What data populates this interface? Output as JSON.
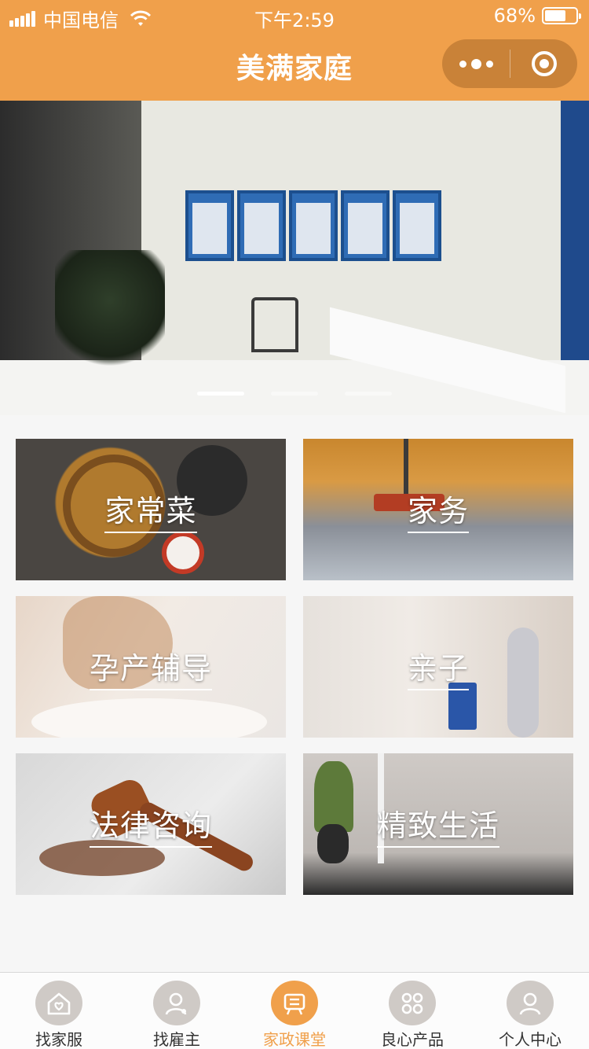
{
  "status_bar": {
    "carrier": "中国电信",
    "time": "下午2:59",
    "battery": "68%",
    "battery_level": 0.68
  },
  "nav": {
    "title": "美满家庭"
  },
  "banner": {
    "slide_count": 3,
    "active_slide": 1
  },
  "categories": [
    {
      "label": "家常菜"
    },
    {
      "label": "家务"
    },
    {
      "label": "孕产辅导"
    },
    {
      "label": "亲子"
    },
    {
      "label": "法律咨询"
    },
    {
      "label": "精致生活"
    }
  ],
  "tabbar": {
    "active_index": 2,
    "items": [
      {
        "label": "找家服",
        "icon": "home-heart-icon"
      },
      {
        "label": "找雇主",
        "icon": "user-icon"
      },
      {
        "label": "家政课堂",
        "icon": "classroom-icon"
      },
      {
        "label": "良心产品",
        "icon": "grid-icon"
      },
      {
        "label": "个人中心",
        "icon": "person-icon"
      }
    ]
  },
  "colors": {
    "accent": "#f0a04b",
    "capsule": "#c98238",
    "tab_inactive": "#cfcac6"
  }
}
